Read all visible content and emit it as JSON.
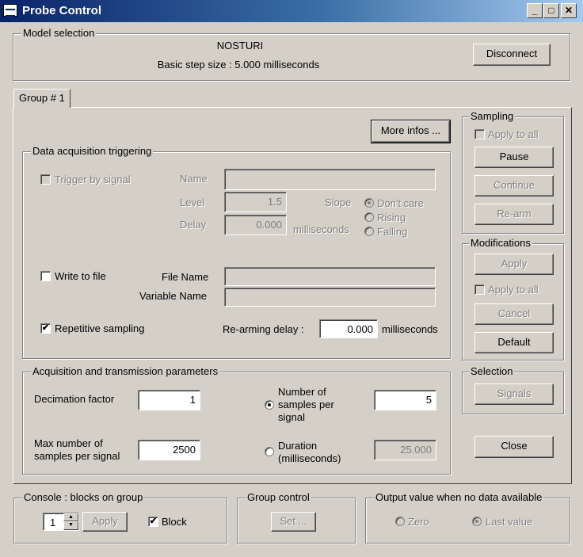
{
  "window": {
    "title": "Probe Control",
    "controls": {
      "minimize": "_",
      "maximize": "□",
      "close": "✕"
    }
  },
  "model_selection": {
    "label": "Model selection",
    "model_name": "NOSTURI",
    "step_size": "Basic step size : 5.000 milliseconds",
    "disconnect_label": "Disconnect"
  },
  "tab": {
    "label": "Group # 1"
  },
  "more_infos_label": "More infos ...",
  "triggering": {
    "label": "Data acquisition triggering",
    "trigger_by_signal": "Trigger by signal",
    "name_label": "Name",
    "name_value": "",
    "level_label": "Level",
    "level_value": "1.5",
    "delay_label": "Delay",
    "delay_value": "0.000",
    "milliseconds": "milliseconds",
    "slope_label": "Slope",
    "slope_options": [
      "Don't care",
      "Rising",
      "Falling"
    ],
    "write_to_file": "Write to file",
    "file_name_label": "File Name",
    "file_name_value": "",
    "variable_name_label": "Variable Name",
    "variable_name_value": "",
    "repetitive_sampling": "Repetitive sampling",
    "rearming_delay_label": "Re-arming delay :",
    "rearming_delay_value": "0.000",
    "rearming_unit": "milliseconds"
  },
  "acquisition": {
    "label": "Acquisition and transmission parameters",
    "decimation_label": "Decimation factor",
    "decimation_value": "1",
    "max_samples_label1": "Max number of",
    "max_samples_label2": "samples per signal",
    "max_samples_value": "2500",
    "num_samples_label1": "Number of",
    "num_samples_label2": "samples per",
    "num_samples_label3": "signal",
    "num_samples_value": "5",
    "duration_label1": "Duration",
    "duration_label2": "(milliseconds)",
    "duration_value": "25.000"
  },
  "sampling": {
    "label": "Sampling",
    "apply_to_all": "Apply to all",
    "pause": "Pause",
    "continue": "Continue",
    "rearm": "Re-arm"
  },
  "modifications": {
    "label": "Modifications",
    "apply": "Apply",
    "apply_to_all": "Apply to all",
    "cancel": "Cancel",
    "default": "Default"
  },
  "selection": {
    "label": "Selection",
    "signals": "Signals"
  },
  "close_label": "Close",
  "console": {
    "label": "Console : blocks on group",
    "group_value": "1",
    "apply_label": "Apply",
    "block_label": "Block"
  },
  "group_control": {
    "label": "Group control",
    "set_label": "Set ..."
  },
  "output_value": {
    "label": "Output value when no data available",
    "zero": "Zero",
    "last_value": "Last value"
  }
}
